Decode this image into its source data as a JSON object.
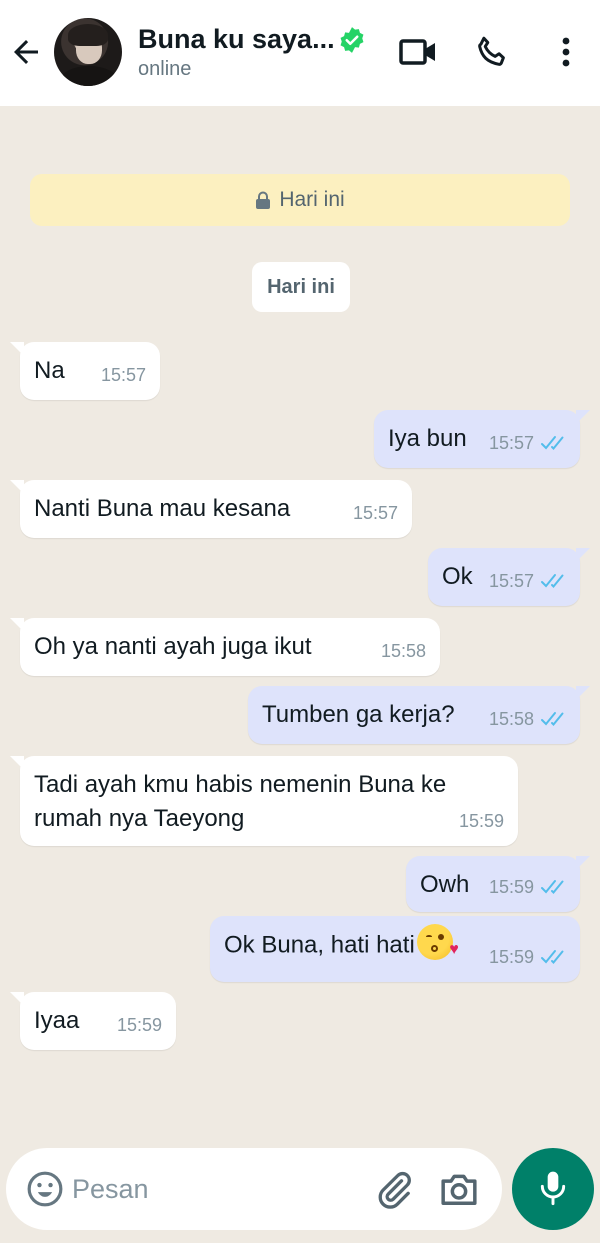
{
  "header": {
    "contact_name": "Buna ku saya...",
    "status": "online"
  },
  "chat": {
    "encryption_notice": "Hari ini",
    "date_chip": "Hari ini",
    "messages": [
      {
        "dir": "in",
        "text": "Na",
        "time": "15:57"
      },
      {
        "dir": "out",
        "text": "Iya bun",
        "time": "15:57",
        "read": true
      },
      {
        "dir": "in",
        "text": "Nanti Buna mau kesana",
        "time": "15:57"
      },
      {
        "dir": "out",
        "text": "Ok",
        "time": "15:57",
        "read": true
      },
      {
        "dir": "in",
        "text": "Oh ya nanti ayah juga ikut",
        "time": "15:58"
      },
      {
        "dir": "out",
        "text": "Tumben ga kerja?",
        "time": "15:58",
        "read": true
      },
      {
        "dir": "in",
        "text_line1": "Tadi ayah kmu habis nemenin Buna ke",
        "text_line2": "rumah nya Taeyong",
        "time": "15:59"
      },
      {
        "dir": "out",
        "text": "Owh",
        "time": "15:59",
        "read": true
      },
      {
        "dir": "out",
        "text": "Ok Buna, hati hati",
        "emoji": "kiss-emoji",
        "time": "15:59",
        "read": true
      },
      {
        "dir": "in",
        "text": "Iyaa",
        "time": "15:59"
      }
    ]
  },
  "composer": {
    "placeholder": "Pesan"
  },
  "colors": {
    "accent": "#008069",
    "verified": "#25d366",
    "read_ticks": "#53bdeb",
    "chat_bg": "#efeae2",
    "outgoing_bubble": "#dee3fb",
    "encryption_bg": "#fcf0c0"
  },
  "icons": [
    "back-arrow-icon",
    "verified-icon",
    "video-call-icon",
    "phone-icon",
    "more-vert-icon",
    "lock-icon",
    "double-check-icon",
    "emoji-icon",
    "attach-icon",
    "camera-icon",
    "mic-icon"
  ]
}
